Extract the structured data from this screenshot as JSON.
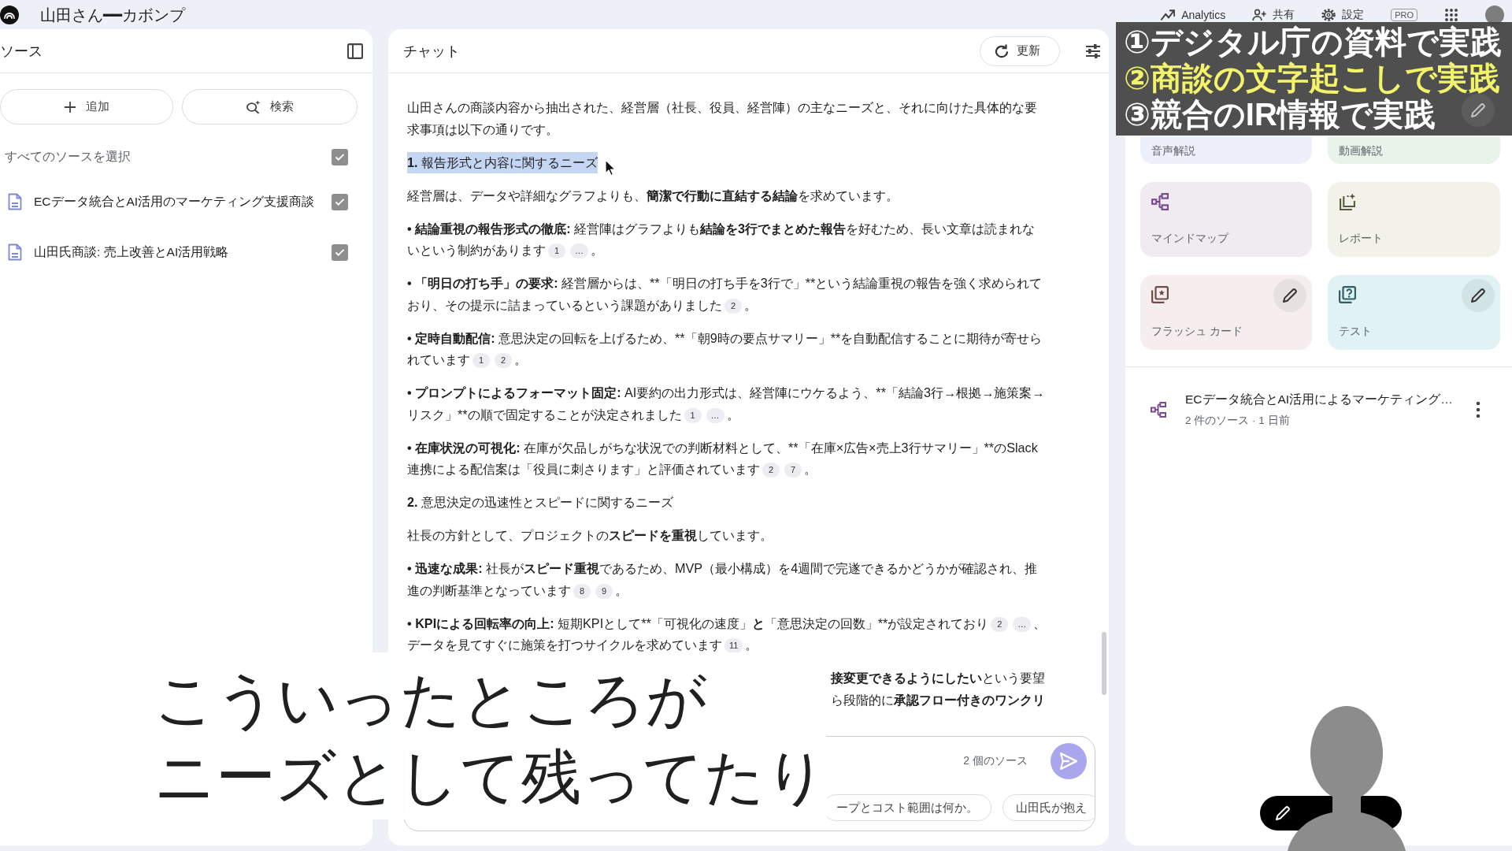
{
  "topbar": {
    "notebook_title": "山田さん━━カボンプ",
    "actions": [
      {
        "kind": "analytics",
        "label": "Analytics"
      },
      {
        "kind": "share",
        "label": "共有"
      },
      {
        "kind": "settings",
        "label": "設定"
      }
    ],
    "plan_badge": "PRO"
  },
  "sources": {
    "title": "ソース",
    "add_label": "追加",
    "search_label": "検索",
    "select_all": {
      "label": "すべてのソースを選択",
      "checked": true
    },
    "items": [
      {
        "title": "ECデータ統合とAI活用のマーケティング支援商談",
        "checked": true
      },
      {
        "title": "山田氏商談: 売上改善とAI活用戦略",
        "checked": true
      }
    ]
  },
  "chat": {
    "title": "チャット",
    "refresh_label": "更新",
    "blocks": [
      {
        "kind": "paragraph",
        "highlighted": false,
        "content": [
          {
            "kind": "text",
            "text": "山田さんの商談内容から抽出された、経営層（社長、役員、経営陣）の主なニーズと、それに向けた具体的な要求事項は以下の通りです。",
            "bold": false
          }
        ]
      },
      {
        "kind": "paragraph",
        "highlighted": true,
        "content": [
          {
            "kind": "text",
            "text": "1.",
            "bold": true
          },
          {
            "kind": "text",
            "text": " 報告形式と内容に関するニーズ",
            "bold": false
          }
        ]
      },
      {
        "kind": "paragraph",
        "highlighted": false,
        "content": [
          {
            "kind": "text",
            "text": "経営層は、データや詳細なグラフよりも、",
            "bold": false
          },
          {
            "kind": "text",
            "text": "簡潔で行動に直結する結論",
            "bold": true
          },
          {
            "kind": "text",
            "text": "を求めています。",
            "bold": false
          }
        ]
      },
      {
        "kind": "paragraph",
        "highlighted": false,
        "content": [
          {
            "kind": "text",
            "text": "• 結論重視の報告形式の徹底:",
            "bold": true
          },
          {
            "kind": "text",
            "text": " 経営陣はグラフよりも",
            "bold": false
          },
          {
            "kind": "text",
            "text": "結論を3行でまとめた報告",
            "bold": true
          },
          {
            "kind": "text",
            "text": "を好むため、長い文章は読まれないという制約があります",
            "bold": false
          },
          {
            "kind": "cite",
            "label": "1"
          },
          {
            "kind": "cite",
            "label": "…"
          },
          {
            "kind": "text",
            "text": "。",
            "bold": false
          }
        ]
      },
      {
        "kind": "paragraph",
        "highlighted": false,
        "content": [
          {
            "kind": "text",
            "text": "• 「明日の打ち手」の要求:",
            "bold": true
          },
          {
            "kind": "text",
            "text": " 経営層からは、**「明日の打ち手を3行で」**という結論重視の報告を強く求められており、その提示に詰まっているという課題がありました",
            "bold": false
          },
          {
            "kind": "cite",
            "label": "2"
          },
          {
            "kind": "text",
            "text": "。",
            "bold": false
          }
        ]
      },
      {
        "kind": "paragraph",
        "highlighted": false,
        "content": [
          {
            "kind": "text",
            "text": "• 定時自動配信:",
            "bold": true
          },
          {
            "kind": "text",
            "text": " 意思決定の回転を上げるため、**「朝9時の要点サマリー」**を自動配信することに期待が寄せられています",
            "bold": false
          },
          {
            "kind": "cite",
            "label": "1"
          },
          {
            "kind": "cite",
            "label": "2"
          },
          {
            "kind": "text",
            "text": "。",
            "bold": false
          }
        ]
      },
      {
        "kind": "paragraph",
        "highlighted": false,
        "content": [
          {
            "kind": "text",
            "text": "• プロンプトによるフォーマット固定:",
            "bold": true
          },
          {
            "kind": "text",
            "text": " AI要約の出力形式は、経営陣にウケるよう、**「結論3行→根拠→施策案→リスク」**の順で固定することが決定されました",
            "bold": false
          },
          {
            "kind": "cite",
            "label": "1"
          },
          {
            "kind": "cite",
            "label": "…"
          },
          {
            "kind": "text",
            "text": "。",
            "bold": false
          }
        ]
      },
      {
        "kind": "paragraph",
        "highlighted": false,
        "content": [
          {
            "kind": "text",
            "text": "• 在庫状況の可視化:",
            "bold": true
          },
          {
            "kind": "text",
            "text": " 在庫が欠品しがちな状況での判断材料として、**「在庫×広告×売上3行サマリー」**のSlack連携による配信案は「役員に刺さります」と評価されています",
            "bold": false
          },
          {
            "kind": "cite",
            "label": "2"
          },
          {
            "kind": "cite",
            "label": "7"
          },
          {
            "kind": "text",
            "text": "。",
            "bold": false
          }
        ]
      },
      {
        "kind": "paragraph",
        "highlighted": false,
        "content": [
          {
            "kind": "text",
            "text": "2.",
            "bold": true
          },
          {
            "kind": "text",
            "text": " 意思決定の迅速性とスピードに関するニーズ",
            "bold": false
          }
        ]
      },
      {
        "kind": "paragraph",
        "highlighted": false,
        "content": [
          {
            "kind": "text",
            "text": "社長の方針として、プロジェクトの",
            "bold": false
          },
          {
            "kind": "text",
            "text": "スピードを重視",
            "bold": true
          },
          {
            "kind": "text",
            "text": "しています。",
            "bold": false
          }
        ]
      },
      {
        "kind": "paragraph",
        "highlighted": false,
        "content": [
          {
            "kind": "text",
            "text": "• 迅速な成果:",
            "bold": true
          },
          {
            "kind": "text",
            "text": " 社長が",
            "bold": false
          },
          {
            "kind": "text",
            "text": "スピード重視",
            "bold": true
          },
          {
            "kind": "text",
            "text": "であるため、MVP（最小構成）を4週間で完遂できるかどうかが確認され、推進の判断基準となっています",
            "bold": false
          },
          {
            "kind": "cite",
            "label": "8"
          },
          {
            "kind": "cite",
            "label": "9"
          },
          {
            "kind": "text",
            "text": "。",
            "bold": false
          }
        ]
      },
      {
        "kind": "paragraph",
        "highlighted": false,
        "content": [
          {
            "kind": "text",
            "text": "• KPIによる回転率の向上:",
            "bold": true
          },
          {
            "kind": "text",
            "text": " 短期KPIとして**「可視化の速度」",
            "bold": false
          },
          {
            "kind": "text",
            "text": "と",
            "bold": true
          },
          {
            "kind": "text",
            "text": "「意思決定の回数」**が設定されており",
            "bold": false
          },
          {
            "kind": "cite",
            "label": "2"
          },
          {
            "kind": "cite",
            "label": "…"
          },
          {
            "kind": "text",
            "text": "、データを見てすぐに施策を打つサイクルを求めています",
            "bold": false
          },
          {
            "kind": "cite",
            "label": "11"
          },
          {
            "kind": "text",
            "text": "。",
            "bold": false
          }
        ]
      },
      {
        "kind": "fragment",
        "highlighted": false,
        "lines": [
          [
            {
              "kind": "text",
              "text": "接変更できるようにしたい",
              "bold": true
            },
            {
              "kind": "text",
              "text": "という要望",
              "bold": false
            }
          ],
          [
            {
              "kind": "text",
              "text": "ら段階的に",
              "bold": false
            },
            {
              "kind": "text",
              "text": "承認フロー付きのワンクリ",
              "bold": true
            }
          ]
        ]
      }
    ],
    "input": {
      "source_count": "2 個のソース",
      "suggestions": [
        "ープとコスト範囲は何か。",
        "山田氏が抱え"
      ]
    }
  },
  "studio": {
    "tiles": [
      {
        "kind": "audio",
        "label": "音声解説",
        "color": "#edf0fa"
      },
      {
        "kind": "video",
        "label": "動画解説",
        "color": "#e8f3e9",
        "editable": true
      },
      {
        "kind": "mindmap",
        "label": "マインドマップ",
        "color": "#efebf1",
        "editable": false
      },
      {
        "kind": "report",
        "label": "レポート",
        "color": "#f3f2ea",
        "editable": false
      },
      {
        "kind": "flashcards",
        "label": "フラッシュ カード",
        "color": "#f6eeee",
        "editable": true
      },
      {
        "kind": "quiz",
        "label": "テスト",
        "color": "#e0f2f4",
        "editable": true
      }
    ],
    "notes": [
      {
        "kind": "mindmap",
        "title": "ECデータ統合とAI活用によるマーケティング…",
        "meta": "2 件のソース · 1 日前"
      }
    ]
  },
  "overlay_banner": {
    "lines": [
      {
        "text": "①デジタル庁の資料で実践",
        "highlighted": false
      },
      {
        "text": "②商談の文字起こしで実践",
        "highlighted": true
      },
      {
        "text": "③競合のIR情報で実践",
        "highlighted": false
      }
    ]
  },
  "caption": {
    "lines": [
      "こういったところが",
      "ニーズとして残ってたり"
    ]
  }
}
